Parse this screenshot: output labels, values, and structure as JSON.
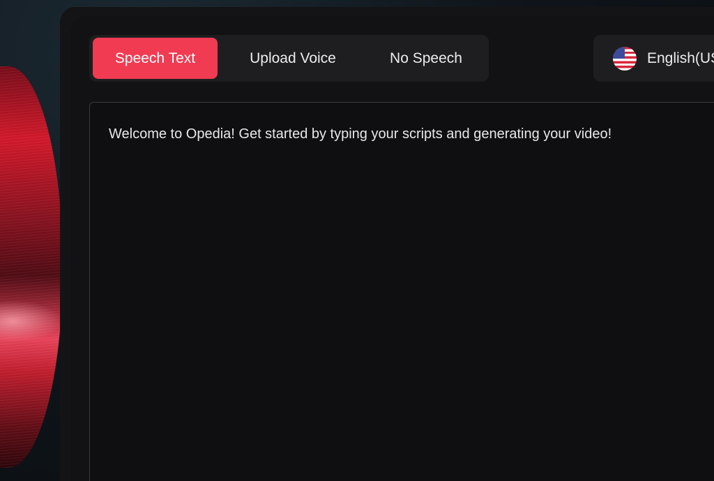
{
  "tabs": [
    {
      "label": "Speech Text",
      "active": true
    },
    {
      "label": "Upload Voice",
      "active": false
    },
    {
      "label": "No Speech",
      "active": false
    }
  ],
  "language": {
    "label": "English(US",
    "icon": "us-flag-icon"
  },
  "editor": {
    "text": "Welcome to Opedia! Get started by typing your scripts and generating your video!"
  },
  "colors": {
    "accent": "#f03b52",
    "panel": "#121214",
    "tab_bg": "#1e1e21"
  }
}
